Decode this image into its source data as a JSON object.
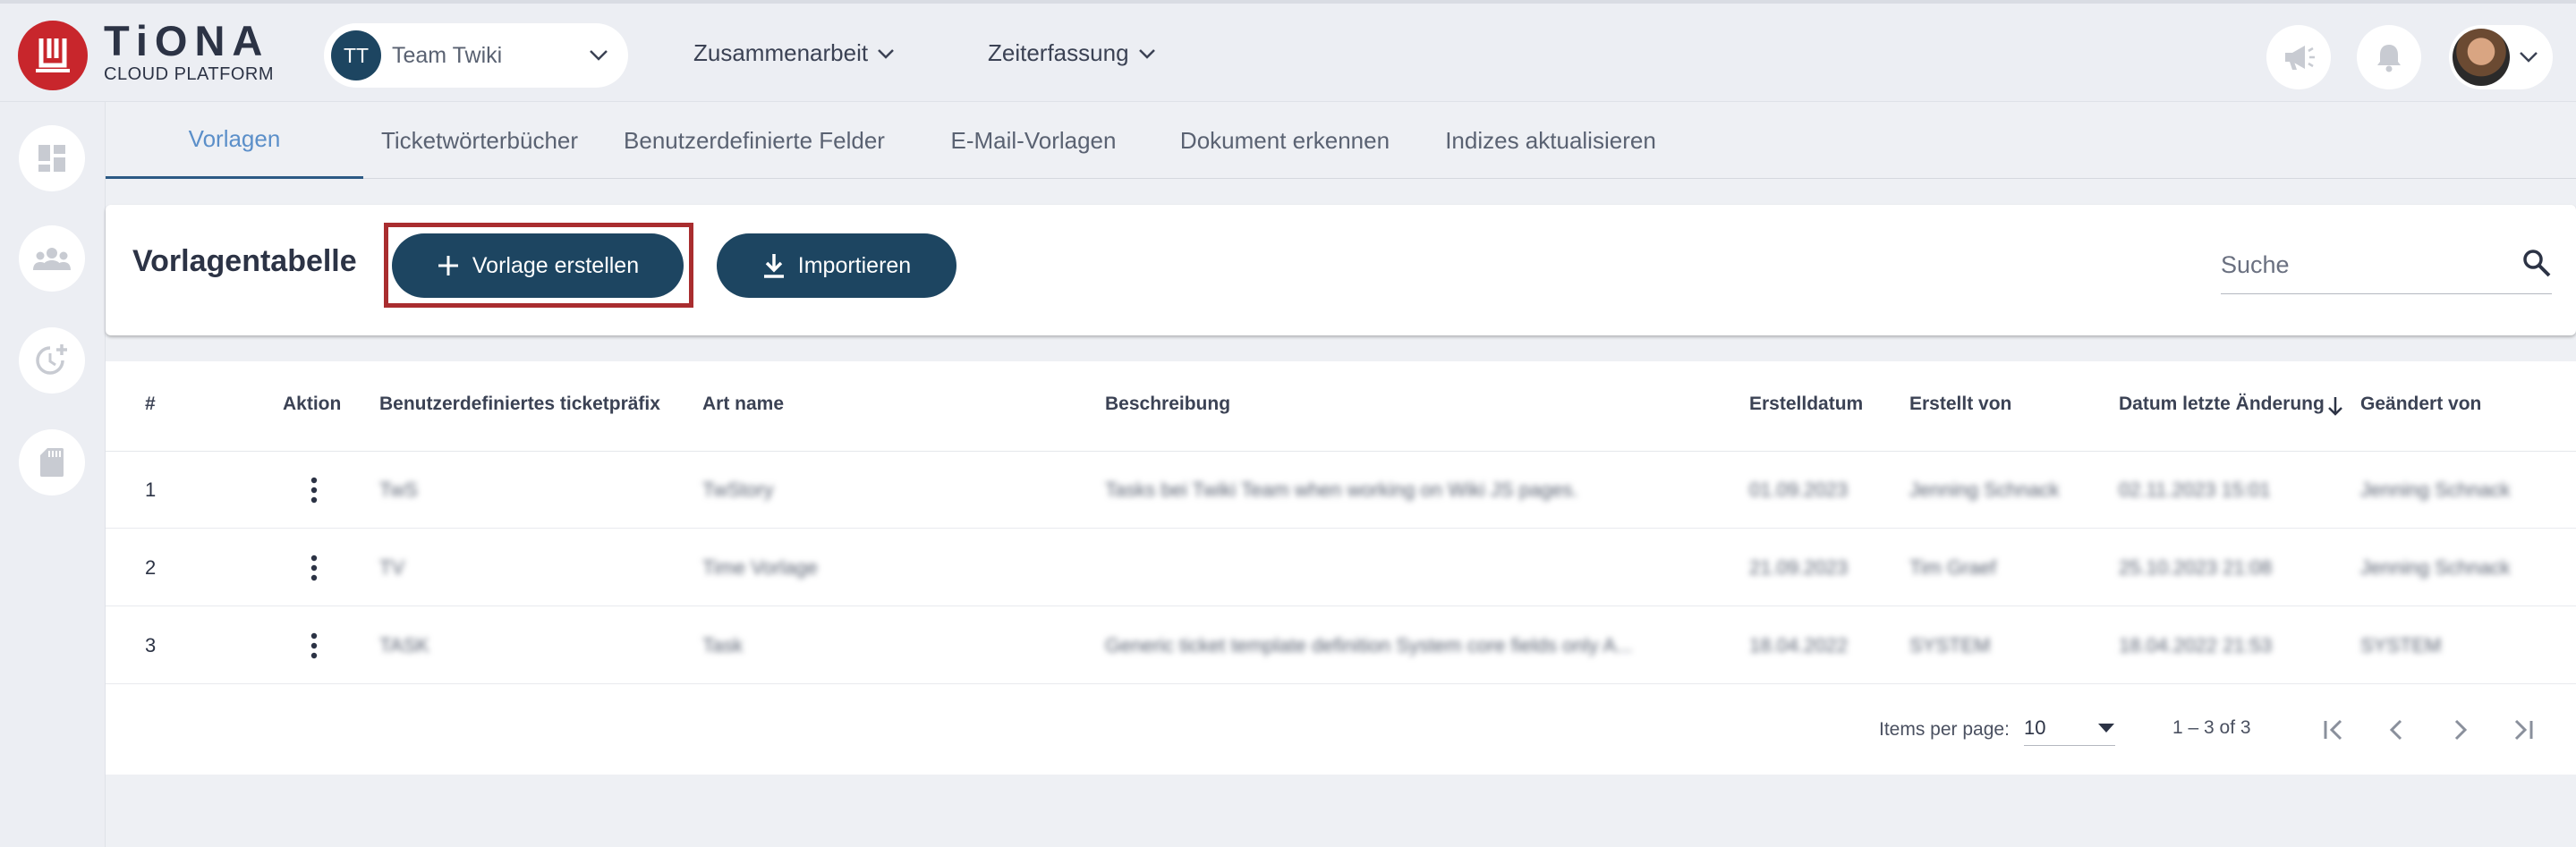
{
  "brand": {
    "title": "TiONA",
    "subtitle": "CLOUD PLATFORM",
    "logo_color": "#c8262c"
  },
  "team": {
    "initials": "TT",
    "name": "Team Twiki"
  },
  "nav": [
    {
      "label": "Zusammenarbeit"
    },
    {
      "label": "Zeiterfassung"
    }
  ],
  "header_icons": [
    "megaphone-icon",
    "bell-icon",
    "user-avatar"
  ],
  "sidebar_icons": [
    "dashboard-icon",
    "group-icon",
    "time-add-icon",
    "sd-card-icon"
  ],
  "tabs": [
    {
      "label": "Vorlagen",
      "active": true
    },
    {
      "label": "Ticketwörterbücher"
    },
    {
      "label": "Benutzerdefinierte Felder"
    },
    {
      "label": "E-Mail-Vorlagen"
    },
    {
      "label": "Dokument erkennen"
    },
    {
      "label": "Indizes aktualisieren"
    }
  ],
  "toolbar": {
    "title": "Vorlagentabelle",
    "create_label": "Vorlage erstellen",
    "import_label": "Importieren",
    "search_placeholder": "Suche"
  },
  "table": {
    "columns": [
      "#",
      "Aktion",
      "Benutzerdefiniertes ticketpräfix",
      "Art name",
      "Beschreibung",
      "Erstelldatum",
      "Erstellt von",
      "Datum letzte Änderung",
      "Geändert von"
    ],
    "sort_column": "Datum letzte Änderung",
    "rows": [
      {
        "n": "1",
        "prefix": "TwS",
        "art": "TwStory",
        "desc": "Tasks bei Twiki Team when working on Wiki JS pages.",
        "created": "01.09.2023",
        "created_by": "Jenning Schnack",
        "modified": "02.11.2023 15:01",
        "modified_by": "Jenning Schnack"
      },
      {
        "n": "2",
        "prefix": "TV",
        "art": "Time Vorlage",
        "desc": "",
        "created": "21.09.2023",
        "created_by": "Tim Graef",
        "modified": "25.10.2023 21:08",
        "modified_by": "Jenning Schnack"
      },
      {
        "n": "3",
        "prefix": "TASK",
        "art": "Task",
        "desc": "Generic ticket template definition System core fields only A...",
        "created": "18.04.2022",
        "created_by": "SYSTEM",
        "modified": "18.04.2022 21:53",
        "modified_by": "SYSTEM"
      }
    ]
  },
  "paginator": {
    "items_per_page_label": "Items per page:",
    "items_per_page": "10",
    "range": "1 – 3 of 3"
  },
  "colors": {
    "primary": "#1d4561",
    "accent_tab": "#5b8fc9",
    "highlight_border": "#a92d2f"
  }
}
